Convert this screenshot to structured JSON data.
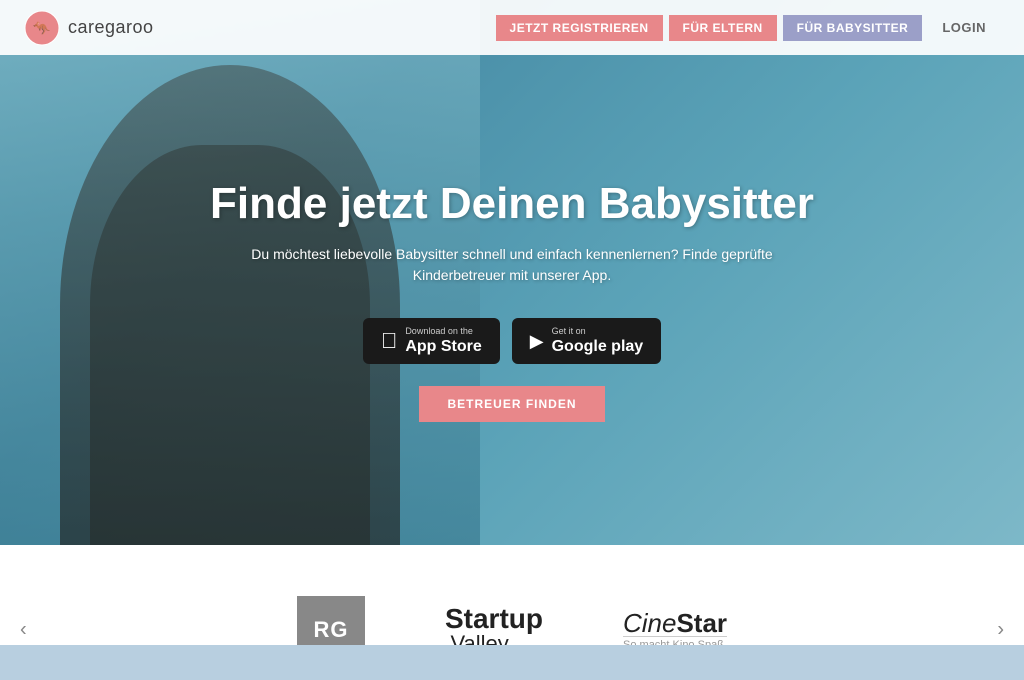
{
  "navbar": {
    "logo_text": "caregaroo",
    "btn_register": "JETZT REGISTRIEREN",
    "btn_eltern": "FÜR ELTERN",
    "btn_babysitter": "FÜR BABYSITTER",
    "btn_login": "LOGIN"
  },
  "hero": {
    "title": "Finde jetzt Deinen Babysitter",
    "subtitle": "Du möchtest liebevolle Babysitter schnell und einfach kennenlernen? Finde geprüfte Kinderbetreuer mit unserer App.",
    "app_store_label_small": "Download on the",
    "app_store_label_large": "App Store",
    "google_play_label_small": "Get it on",
    "google_play_label_large": "Google play",
    "cta_button": "BETREUER FINDEN"
  },
  "partners": {
    "prev_label": "‹",
    "next_label": "›",
    "logos": [
      {
        "name": "RG",
        "type": "rg"
      },
      {
        "name": "Startup Valley .news",
        "type": "startup-valley"
      },
      {
        "name": "CineStar",
        "type": "cinestar"
      }
    ]
  }
}
